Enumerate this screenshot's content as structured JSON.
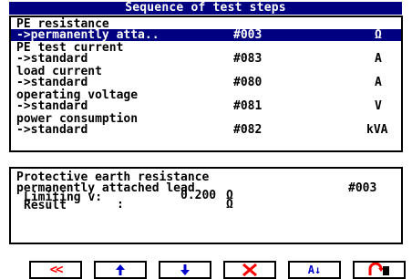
{
  "window": {
    "title": "Sequence of test steps"
  },
  "steps": [
    {
      "name": "PE resistance",
      "variant": "->permanently atta..",
      "id": "#003",
      "unit": "Ω",
      "selected": true
    },
    {
      "name": "PE test current",
      "variant": "->standard",
      "id": "#083",
      "unit": "A",
      "selected": false
    },
    {
      "name": "load current",
      "variant": "->standard",
      "id": "#080",
      "unit": "A",
      "selected": false
    },
    {
      "name": "operating voltage",
      "variant": "->standard",
      "id": "#081",
      "unit": "V",
      "selected": false
    },
    {
      "name": "power consumption",
      "variant": "->standard",
      "id": "#082",
      "unit": "kVA",
      "selected": false
    }
  ],
  "detail": {
    "title": "Protective earth resistance",
    "subtitle": "permanently attached lead",
    "id": "#003",
    "limit_label": "Limiting v:",
    "limit_value": "0.200",
    "limit_unit": "Ω",
    "result_label": "Result",
    "result_sep": ":",
    "result_unit": "Ω"
  },
  "toolbar": {
    "first": "<<",
    "icons": [
      "double-chevron-left-icon",
      "arrow-up-icon",
      "arrow-down-icon",
      "delete-x-icon",
      "sort-icon",
      "exit-door-icon"
    ],
    "sort_glyph": "A↓",
    "colors": {
      "icon": "#0000cc",
      "delete": "#ff0000",
      "double_chevron": "#ff0000"
    }
  }
}
